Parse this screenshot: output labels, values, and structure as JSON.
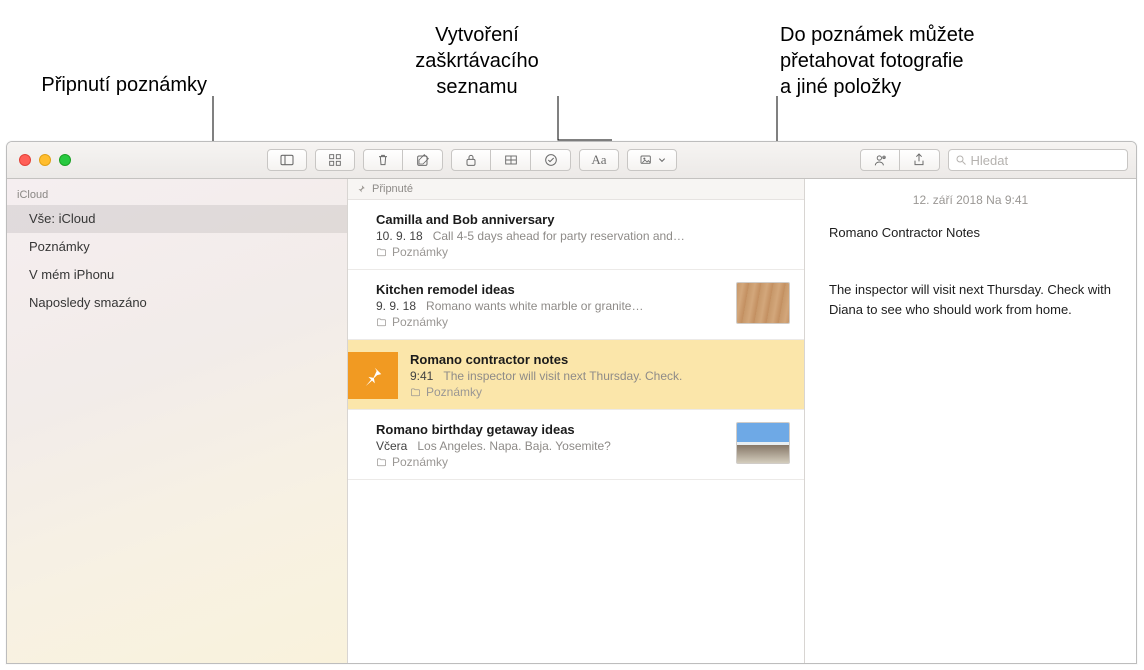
{
  "callouts": {
    "pin": "Připnutí poznámky",
    "checklist": "Vytvoření\nzaškrtávacího\nseznamu",
    "media": "Do poznámek můžete\npřetahovat fotografie\na jiné položky"
  },
  "search": {
    "placeholder": "Hledat"
  },
  "sidebar": {
    "heading": "iCloud",
    "items": [
      {
        "label": "Vše: iCloud",
        "selected": true
      },
      {
        "label": "Poznámky",
        "selected": false
      },
      {
        "label": "V mém iPhonu",
        "selected": false
      },
      {
        "label": "Naposledy smazáno",
        "selected": false
      }
    ]
  },
  "list": {
    "section": "Připnuté",
    "notes": [
      {
        "title": "Camilla and Bob anniversary",
        "date": "10. 9. 18",
        "preview": "Call 4-5 days ahead for party reservation and…",
        "folder": "Poznámky",
        "thumb": null,
        "selected": false
      },
      {
        "title": "Kitchen remodel ideas",
        "date": "9. 9. 18",
        "preview": "Romano wants white marble or granite…",
        "folder": "Poznámky",
        "thumb": "wood",
        "selected": false
      },
      {
        "title": "Romano contractor notes",
        "date": "9:41",
        "preview": "The inspector will visit next Thursday. Check.",
        "folder": "Poznámky",
        "thumb": null,
        "selected": true
      },
      {
        "title": "Romano birthday getaway ideas",
        "date": "Včera",
        "preview": "Los Angeles. Napa. Baja. Yosemite?",
        "folder": "Poznámky",
        "thumb": "beach",
        "selected": false
      }
    ]
  },
  "content": {
    "date": "12. září 2018 Na 9:41",
    "title": "Romano Contractor Notes",
    "body": "The inspector will visit next Thursday. Check with Diana to see who should work from home."
  }
}
